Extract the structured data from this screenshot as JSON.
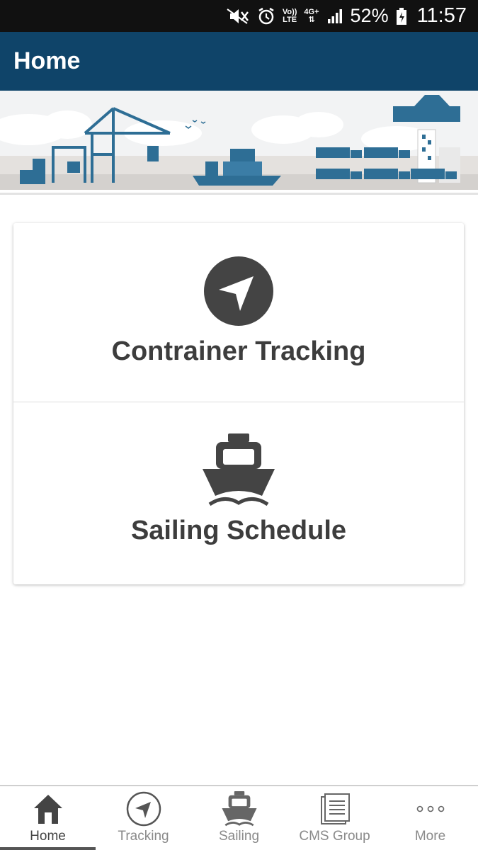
{
  "status_bar": {
    "network_top": "Vo))",
    "network_bottom": "LTE",
    "data_type": "4G+",
    "battery": "52%",
    "time": "11:57",
    "icons": [
      "mute-icon",
      "alarm-icon",
      "volte-icon",
      "data-4g-icon",
      "signal-icon",
      "battery-icon"
    ]
  },
  "header": {
    "title": "Home"
  },
  "banner": {
    "illustration": "port-cranes-ship-trucks",
    "accent_color": "#2e6e95"
  },
  "cards": [
    {
      "label": "Contrainer Tracking",
      "icon": "navigation-arrow-icon"
    },
    {
      "label": "Sailing Schedule",
      "icon": "ship-icon"
    }
  ],
  "bottom_nav": {
    "active_index": 0,
    "items": [
      {
        "label": "Home",
        "icon": "home-icon"
      },
      {
        "label": "Tracking",
        "icon": "navigation-arrow-icon"
      },
      {
        "label": "Sailing",
        "icon": "ship-icon"
      },
      {
        "label": "CMS Group",
        "icon": "document-icon"
      },
      {
        "label": "More",
        "icon": "more-dots-icon"
      }
    ]
  },
  "colors": {
    "app_bar": "#0f4469",
    "status_bar": "#111111",
    "card_text": "#3d3d3d",
    "icon_dark": "#444444",
    "nav_inactive": "#8a8a8a"
  }
}
